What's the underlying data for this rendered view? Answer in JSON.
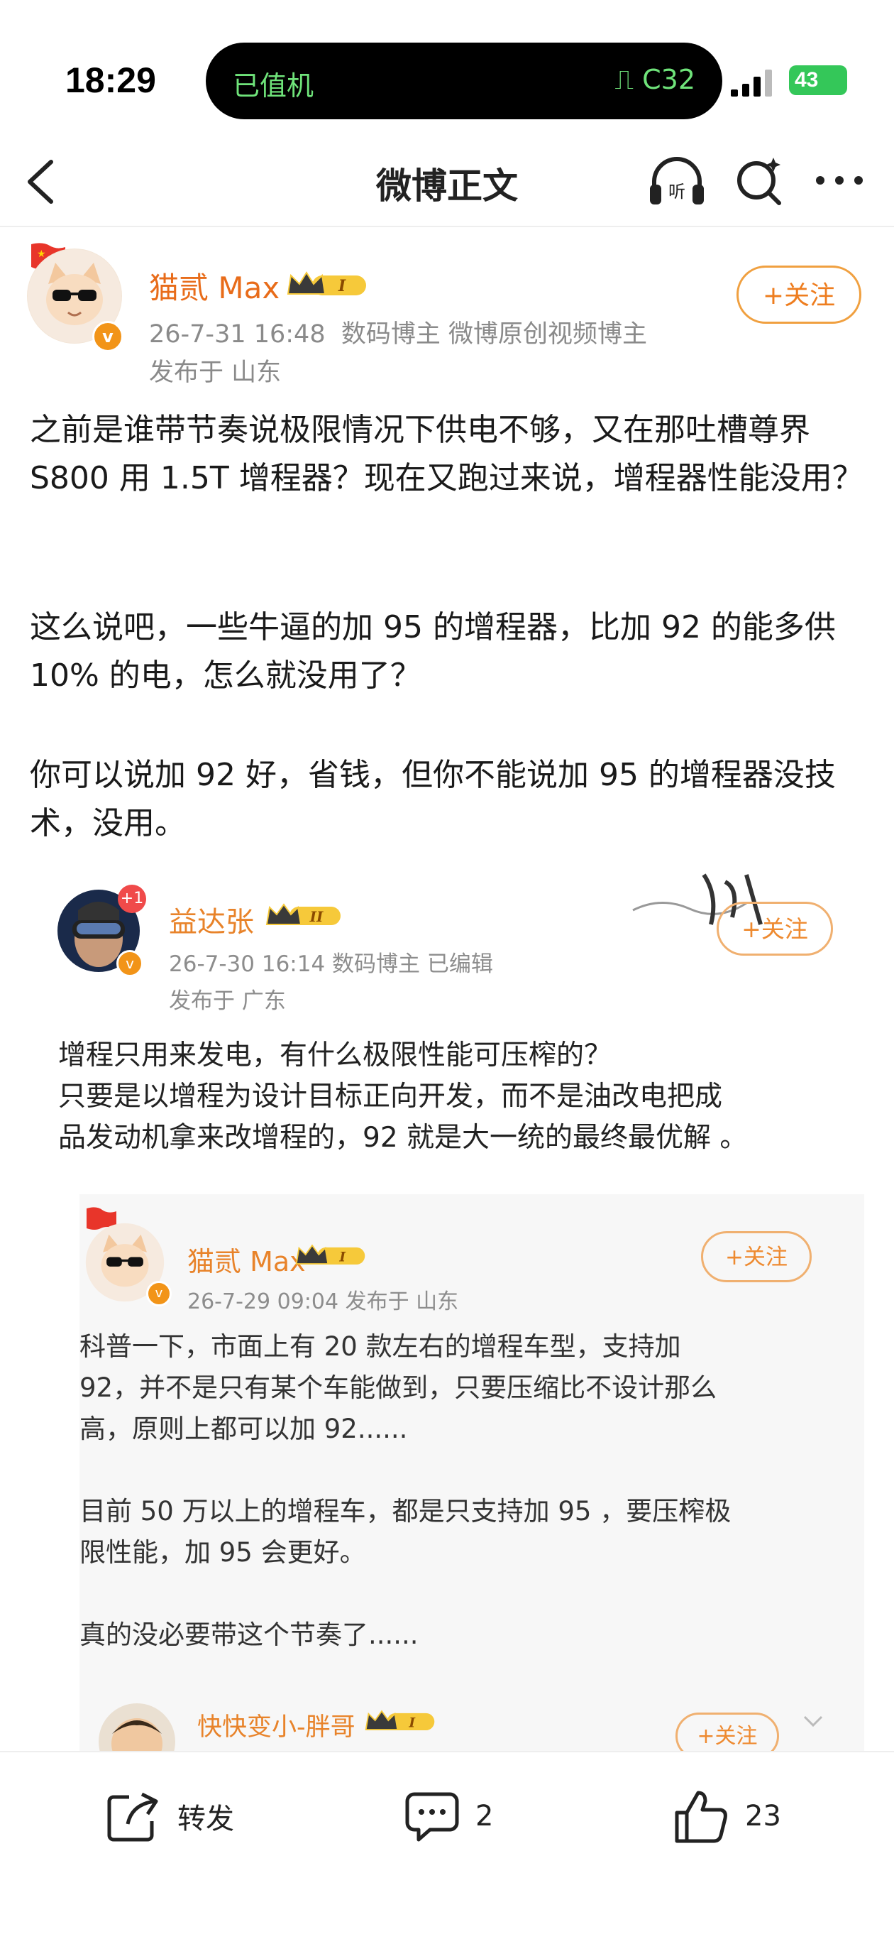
{
  "status_bar": {
    "time": "18:29",
    "island_left": "已值机",
    "island_right": "C32",
    "battery": "43"
  },
  "nav": {
    "title": "微博正文"
  },
  "post": {
    "author": "猫贰 Max",
    "level": "I",
    "date": "26-7-31 16:48",
    "tags": "数码博主 微博原创视频博主",
    "location": "发布于 山东",
    "follow": "+关注",
    "paragraphs": [
      "之前是谁带节奏说极限情况下供电不够，又在那吐槽尊界 S800 用 1.5T 增程器？现在又跑过来说，增程器性能没用？",
      "这么说吧，一些牛逼的加 95 的增程器，比加 92 的能多供 10% 的电，怎么就没用了？",
      "你可以说加 92 好，省钱，但你不能说加 95 的增程器没技术，没用。"
    ]
  },
  "quoted": {
    "author": "益达张",
    "level": "II",
    "avatar_badge": "+1",
    "meta": "26-7-30 16:14  数码博主  已编辑",
    "location": "发布于 广东",
    "follow": "+关注",
    "text_lines": [
      "增程只用来发电，有什么极限性能可压榨的？",
      "只要是以增程为设计目标正向开发，而不是油改电把成",
      "品发动机拿来改增程的，92 就是大一统的最终最优解 。"
    ],
    "nested": {
      "author": "猫贰 Max",
      "level": "I",
      "meta": "26-7-29 09:04  发布于 山东",
      "follow": "+关注",
      "text_lines": [
        "科普一下，市面上有 20 款左右的增程车型，支持加",
        "92，并不是只有某个车能做到，只要压缩比不设计那么",
        "高，原则上都可以加 92......",
        "",
        "目前 50 万以上的增程车，都是只支持加 95 ，要压榨极",
        "限性能，加 95 会更好。",
        "",
        "真的没必要带这个节奏了......"
      ],
      "next_author": "快快变小-胖哥",
      "next_level": "I",
      "next_follow": "+关注"
    }
  },
  "actions": {
    "repost": "转发",
    "comments": "2",
    "likes": "23"
  },
  "colors": {
    "accent": "#ee7d1f",
    "meta_gray": "#8a8a8a"
  }
}
